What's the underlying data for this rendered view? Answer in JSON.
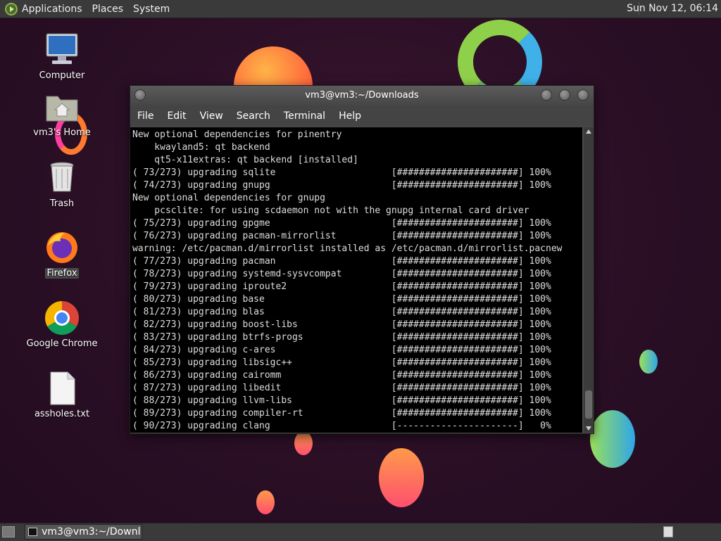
{
  "top_panel": {
    "menus": [
      "Applications",
      "Places",
      "System"
    ],
    "clock": "Sun Nov 12, 06:14"
  },
  "desktop_icons": [
    {
      "label": "Computer",
      "icon": "computer-icon"
    },
    {
      "label": "vm3's Home",
      "icon": "home-folder-icon"
    },
    {
      "label": "Trash",
      "icon": "trash-icon"
    },
    {
      "label": "Firefox",
      "icon": "firefox-icon"
    },
    {
      "label": "Google Chrome",
      "icon": "chrome-icon"
    },
    {
      "label": "assholes.txt",
      "icon": "text-file-icon"
    }
  ],
  "terminal": {
    "title": "vm3@vm3:~/Downloads",
    "menus": [
      "File",
      "Edit",
      "View",
      "Search",
      "Terminal",
      "Help"
    ],
    "lines": [
      "New optional dependencies for pinentry",
      "    kwayland5: qt backend",
      "    qt5-x11extras: qt backend [installed]",
      "( 73/273) upgrading sqlite                     [######################] 100%",
      "( 74/273) upgrading gnupg                      [######################] 100%",
      "New optional dependencies for gnupg",
      "    pcsclite: for using scdaemon not with the gnupg internal card driver",
      "( 75/273) upgrading gpgme                      [######################] 100%",
      "( 76/273) upgrading pacman-mirrorlist          [######################] 100%",
      "warning: /etc/pacman.d/mirrorlist installed as /etc/pacman.d/mirrorlist.pacnew",
      "( 77/273) upgrading pacman                     [######################] 100%",
      "( 78/273) upgrading systemd-sysvcompat         [######################] 100%",
      "( 79/273) upgrading iproute2                   [######################] 100%",
      "( 80/273) upgrading base                       [######################] 100%",
      "( 81/273) upgrading blas                       [######################] 100%",
      "( 82/273) upgrading boost-libs                 [######################] 100%",
      "( 83/273) upgrading btrfs-progs                [######################] 100%",
      "( 84/273) upgrading c-ares                     [######################] 100%",
      "( 85/273) upgrading libsigc++                  [######################] 100%",
      "( 86/273) upgrading cairomm                    [######################] 100%",
      "( 87/273) upgrading libedit                    [######################] 100%",
      "( 88/273) upgrading llvm-libs                  [######################] 100%",
      "( 89/273) upgrading compiler-rt                [######################] 100%",
      "( 90/273) upgrading clang                      [----------------------]   0%"
    ]
  },
  "taskbar": {
    "task_label": "vm3@vm3:~/Downl..."
  }
}
